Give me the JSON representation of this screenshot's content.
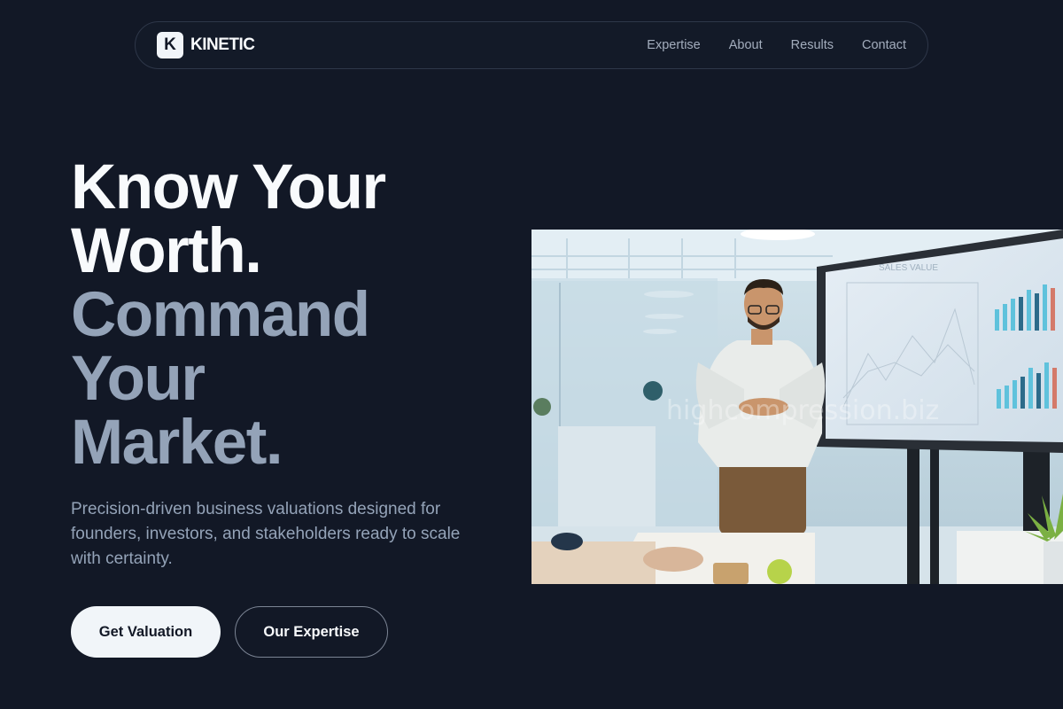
{
  "brand": {
    "mark": "K",
    "name": "KINETIC"
  },
  "nav": {
    "links": [
      {
        "label": "Expertise"
      },
      {
        "label": "About"
      },
      {
        "label": "Results"
      },
      {
        "label": "Contact"
      }
    ]
  },
  "hero": {
    "title_lines": [
      "Know Your",
      "Worth.",
      "Command",
      "Your",
      "Market."
    ],
    "subtitle": "Precision-driven business valuations designed for founders, investors, and stakeholders ready to scale with certainty.",
    "primary_cta": "Get Valuation",
    "secondary_cta": "Our Expertise"
  },
  "image": {
    "screen_label": "SALES VALUE",
    "watermark": "highcompression.biz"
  },
  "colors": {
    "background": "#121826",
    "text": "#f8fafc",
    "muted": "#94a3b8",
    "button_light": "#f1f5f9"
  }
}
